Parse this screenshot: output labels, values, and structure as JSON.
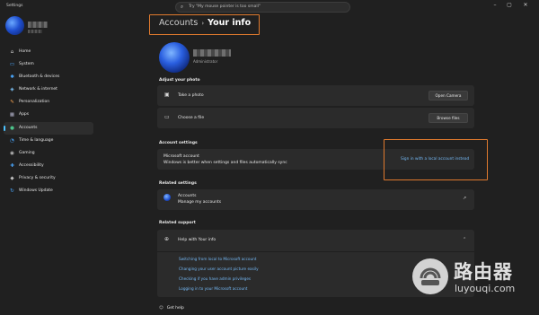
{
  "window": {
    "title": "Settings",
    "search_placeholder": "Try \"My mouse pointer is too small\"",
    "controls": [
      "minimize-icon",
      "maximize-icon",
      "close-icon"
    ]
  },
  "sidebar": {
    "items": [
      {
        "label": "Home",
        "icon": "home-icon",
        "glyph": "⌂",
        "color": "#d8d8d8"
      },
      {
        "label": "System",
        "icon": "monitor-icon",
        "glyph": "▭",
        "color": "#4aa8ff"
      },
      {
        "label": "Bluetooth & devices",
        "icon": "bluetooth-icon",
        "glyph": "✱",
        "color": "#4aa8ff"
      },
      {
        "label": "Network & internet",
        "icon": "wifi-icon",
        "glyph": "◈",
        "color": "#7ec8ff"
      },
      {
        "label": "Personalization",
        "icon": "brush-icon",
        "glyph": "✎",
        "color": "#f0a050"
      },
      {
        "label": "Apps",
        "icon": "apps-icon",
        "glyph": "▦",
        "color": "#b0b0c8"
      },
      {
        "label": "Accounts",
        "icon": "person-icon",
        "glyph": "●",
        "color": "#4cc28a",
        "active": true
      },
      {
        "label": "Time & language",
        "icon": "globe-clock-icon",
        "glyph": "◔",
        "color": "#4aa8ff"
      },
      {
        "label": "Gaming",
        "icon": "gamepad-icon",
        "glyph": "◉",
        "color": "#c0c0c0"
      },
      {
        "label": "Accessibility",
        "icon": "accessibility-icon",
        "glyph": "✚",
        "color": "#4aa8ff"
      },
      {
        "label": "Privacy & security",
        "icon": "shield-icon",
        "glyph": "◆",
        "color": "#c0c0c0"
      },
      {
        "label": "Windows Update",
        "icon": "update-icon",
        "glyph": "↻",
        "color": "#4aa8ff"
      }
    ]
  },
  "breadcrumb": {
    "parent": "Accounts",
    "separator": "›",
    "current": "Your info"
  },
  "profile": {
    "role": "Administrator"
  },
  "adjust_photo": {
    "heading": "Adjust your photo",
    "rows": [
      {
        "label": "Take a photo",
        "icon": "camera-icon",
        "glyph": "▣",
        "button": "Open Camera"
      },
      {
        "label": "Choose a file",
        "icon": "folder-icon",
        "glyph": "▭",
        "button": "Browse files"
      }
    ]
  },
  "account_settings": {
    "heading": "Account settings",
    "title": "Microsoft account",
    "description": "Windows is better when settings and files automatically sync",
    "link": "Sign in with a local account instead"
  },
  "related_settings": {
    "heading": "Related settings",
    "title": "Accounts",
    "description": "Manage my accounts",
    "external_icon": "↗"
  },
  "related_support": {
    "heading": "Related support",
    "expander_title": "Help with Your info",
    "expander_glyph": "⌃",
    "links": [
      "Switching from local to Microsoft account",
      "Changing your user account picture easily",
      "Checking if you have admin privileges",
      "Logging in to your Microsoft account"
    ]
  },
  "get_help": "Get help",
  "watermark": {
    "cn": "路由器",
    "en": "luyouqi.com"
  }
}
